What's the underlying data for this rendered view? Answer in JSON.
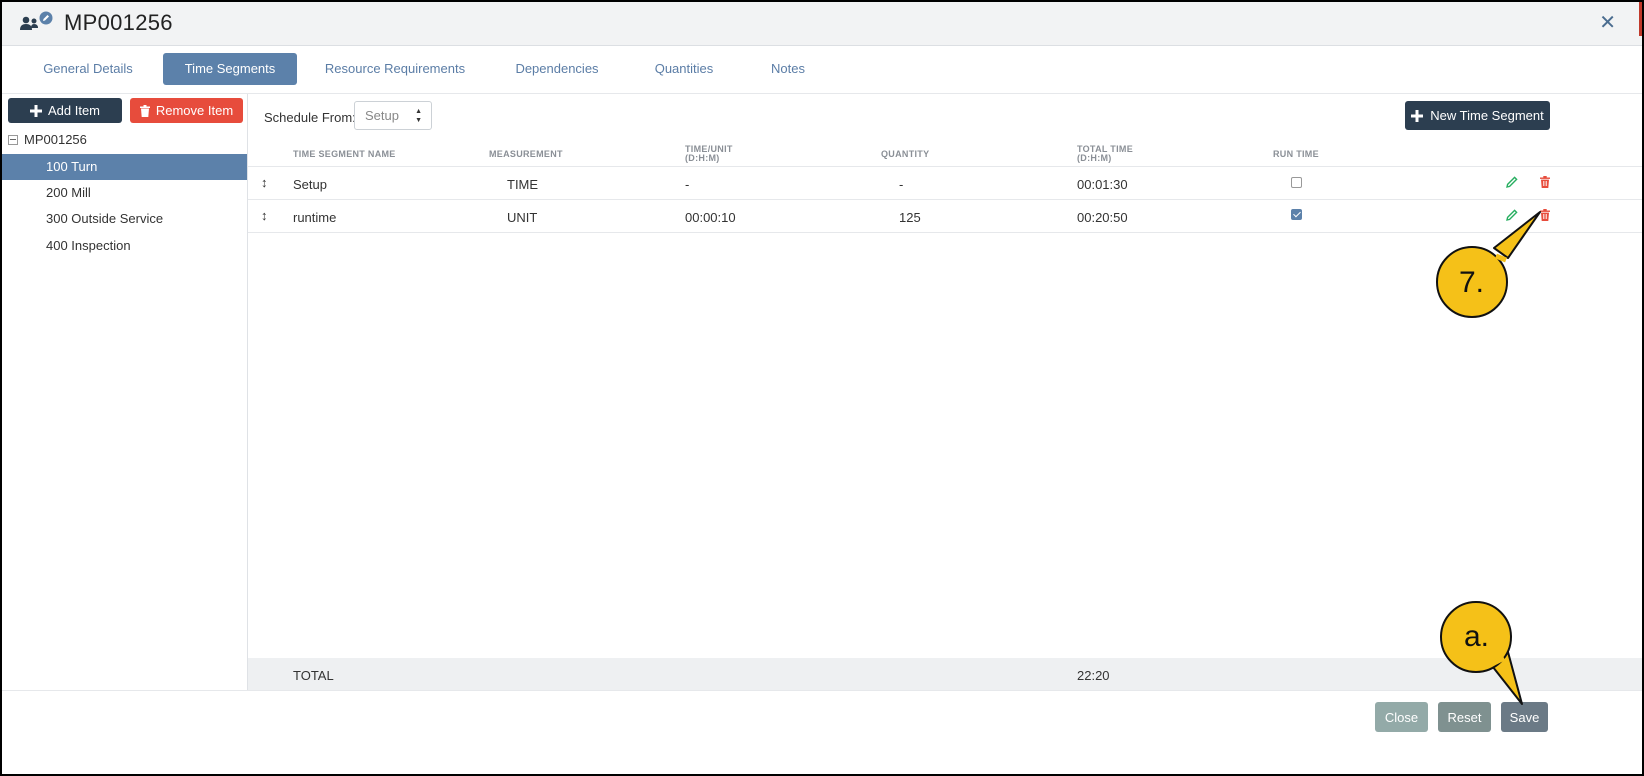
{
  "header": {
    "title": "MP001256",
    "icon": "users-edit-icon",
    "close_icon": "close-icon"
  },
  "tabs": [
    {
      "label": "General Details",
      "active": false
    },
    {
      "label": "Time Segments",
      "active": true
    },
    {
      "label": "Resource Requirements",
      "active": false
    },
    {
      "label": "Dependencies",
      "active": false
    },
    {
      "label": "Quantities",
      "active": false
    },
    {
      "label": "Notes",
      "active": false
    }
  ],
  "sidebar": {
    "add_label": "Add Item",
    "remove_label": "Remove Item",
    "root": "MP001256",
    "items": [
      {
        "label": "100 Turn",
        "selected": true
      },
      {
        "label": "200 Mill",
        "selected": false
      },
      {
        "label": "300 Outside Service",
        "selected": false
      },
      {
        "label": "400 Inspection",
        "selected": false
      }
    ]
  },
  "main": {
    "schedule_from_label": "Schedule From:",
    "schedule_from_value": "Setup",
    "new_segment_label": "New Time Segment",
    "columns": {
      "name": "TIME SEGMENT NAME",
      "measurement": "MEASUREMENT",
      "time_unit": "TIME/UNIT",
      "time_unit_sub": "(D:H:M)",
      "quantity": "QUANTITY",
      "total_time": "TOTAL TIME",
      "total_time_sub": "(D:H:M)",
      "run_time": "RUN TIME"
    },
    "rows": [
      {
        "name": "Setup",
        "measurement": "TIME",
        "time_unit": "-",
        "quantity": "-",
        "total_time": "00:01:30",
        "run_time": false
      },
      {
        "name": "runtime",
        "measurement": "UNIT",
        "time_unit": "00:00:10",
        "quantity": "125",
        "total_time": "00:20:50",
        "run_time": true
      }
    ],
    "total_label": "TOTAL",
    "total_value": "22:20"
  },
  "footer": {
    "close_label": "Close",
    "reset_label": "Reset",
    "save_label": "Save"
  },
  "callouts": {
    "step7": "7.",
    "stepa": "a."
  },
  "colors": {
    "accent": "#5c81aa",
    "dark": "#2c3e50",
    "danger": "#e74c3c",
    "edit": "#27ae60",
    "callout": "#f5c118"
  }
}
